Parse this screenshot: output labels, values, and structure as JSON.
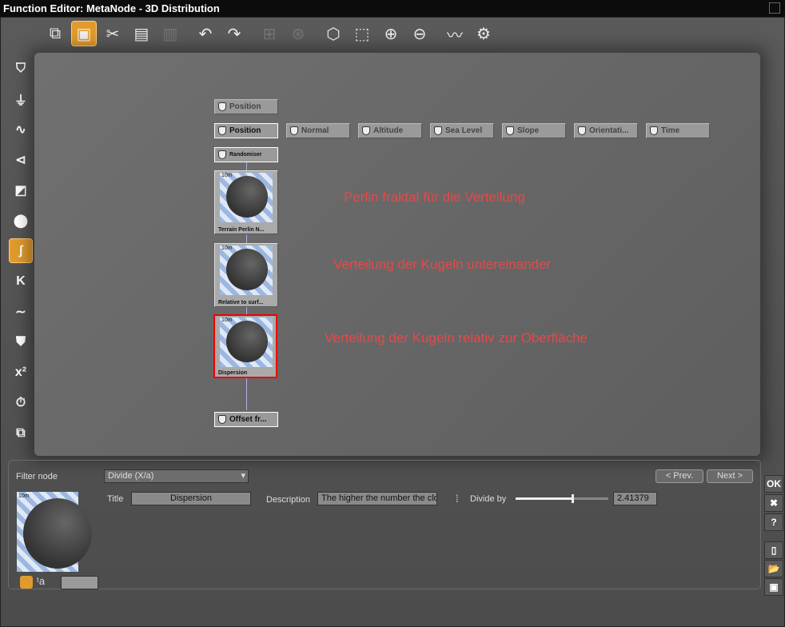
{
  "window": {
    "title": "Function Editor: MetaNode - 3D Distribution"
  },
  "toolbar": [
    {
      "name": "graph-icon",
      "glyph": "⧉"
    },
    {
      "name": "preview-icon",
      "glyph": "▣",
      "active": true
    },
    {
      "name": "cut-icon",
      "glyph": "✂"
    },
    {
      "name": "copy-icon",
      "glyph": "▤"
    },
    {
      "name": "paste-icon",
      "glyph": "▥",
      "disabled": true
    },
    {
      "name": "undo-icon",
      "glyph": "↶"
    },
    {
      "name": "redo-icon",
      "glyph": "↷"
    },
    {
      "name": "group-icon",
      "glyph": "⊞",
      "disabled": true
    },
    {
      "name": "ungroup-icon",
      "glyph": "⊛",
      "disabled": true
    },
    {
      "name": "zoom-object-icon",
      "glyph": "⬡"
    },
    {
      "name": "zoom-region-icon",
      "glyph": "⬚"
    },
    {
      "name": "zoom-in-icon",
      "glyph": "⊕"
    },
    {
      "name": "zoom-out-icon",
      "glyph": "⊖"
    },
    {
      "name": "curve-icon",
      "glyph": "〰"
    },
    {
      "name": "settings-icon",
      "glyph": "⚙"
    }
  ],
  "sidebar": [
    {
      "name": "input-node-icon",
      "glyph": "⛉"
    },
    {
      "name": "output-node-icon",
      "glyph": "⏚"
    },
    {
      "name": "noise-node-icon",
      "glyph": "∿"
    },
    {
      "name": "combiner-node-icon",
      "glyph": "⊲"
    },
    {
      "name": "color-node-icon",
      "glyph": "◩"
    },
    {
      "name": "texture-node-icon",
      "glyph": "⬤"
    },
    {
      "name": "filter-node-icon",
      "glyph": "ʃ",
      "active": true
    },
    {
      "name": "constant-node-icon",
      "glyph": "K"
    },
    {
      "name": "curve-node-icon",
      "glyph": "∼"
    },
    {
      "name": "converter-node-icon",
      "glyph": "⛊"
    },
    {
      "name": "math-node-icon",
      "glyph": "x²"
    },
    {
      "name": "timer-node-icon",
      "glyph": "⏱"
    },
    {
      "name": "group-node-icon",
      "glyph": "⧉"
    }
  ],
  "graph": {
    "top_input": "Position",
    "inputs": [
      "Position",
      "Normal",
      "Altitude",
      "Sea Level",
      "Slope",
      "Orientati...",
      "Time"
    ],
    "randomiser": "Randomiser",
    "preview_nodes": [
      {
        "label": "Terrain Perlin N...",
        "scale": "10m"
      },
      {
        "label": "Relative to surf...",
        "scale": "10m"
      },
      {
        "label": "Dispersion",
        "scale": "10m"
      }
    ],
    "output": "Offset fr..."
  },
  "annotations": [
    "Perlin fraktal für die Verteilung",
    "Verteilung der Kugeln untereinander",
    "Verteilung der Kugeln relativ zur Oberfläche"
  ],
  "panel": {
    "group_label": "Filter node",
    "type": "Divide (X/a)",
    "prev": "< Prev.",
    "next": "Next >",
    "preview_scale": "10m",
    "title_label": "Title",
    "title_value": "Dispersion",
    "description_label": "Description",
    "description_value": "The higher the number the clo",
    "param_label": "Divide by",
    "param_value": "2.41379",
    "slider_fraction": 0.6
  },
  "right_buttons": {
    "ok": "OK",
    "cancel": "✖",
    "help": "?"
  }
}
